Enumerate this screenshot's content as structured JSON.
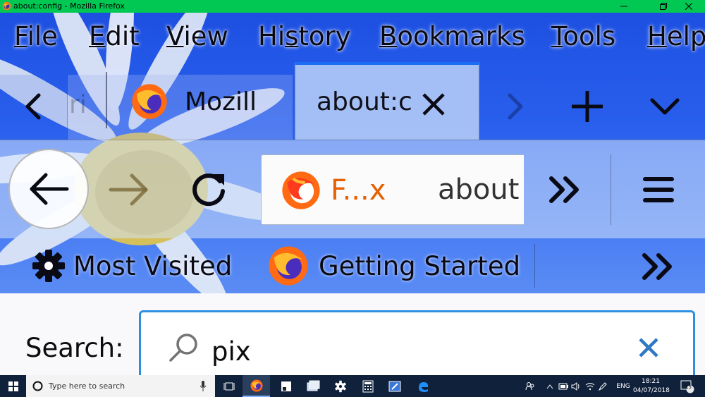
{
  "window": {
    "title": "about:config - Mozilla Firefox"
  },
  "menubar": {
    "items": [
      {
        "label": "File",
        "accel": "F",
        "rest": "ile"
      },
      {
        "label": "Edit",
        "accel": "E",
        "rest": "dit"
      },
      {
        "label": "View",
        "accel": "V",
        "rest": "iew"
      },
      {
        "label": "History",
        "pre": "Hi",
        "accel": "s",
        "rest": "tory"
      },
      {
        "label": "Bookmarks",
        "accel": "B",
        "rest": "ookmarks"
      },
      {
        "label": "Tools",
        "accel": "T",
        "rest": "ools"
      },
      {
        "label": "Help",
        "accel": "H",
        "rest": "elp"
      }
    ]
  },
  "tabs": {
    "partial_left": "ri",
    "inactive_label": "Mozill",
    "active_label": "about:c"
  },
  "urlbar": {
    "identity_label": "F...x",
    "url_text": "about"
  },
  "bookmarks": {
    "most_visited": "Most Visited",
    "getting_started": "Getting Started"
  },
  "content": {
    "search_label_pre": "Search",
    "search_label_accel": "r",
    "search_label": "Search:",
    "search_value": "pix"
  },
  "taskbar": {
    "search_placeholder": "Type here to search",
    "language": "ENG",
    "time": "18:21",
    "date": "04/07/2018",
    "notifications": "15"
  },
  "colors": {
    "titlebar": "#00c853",
    "accent": "#2e8fe0",
    "firefox_orange": "#e66000"
  }
}
